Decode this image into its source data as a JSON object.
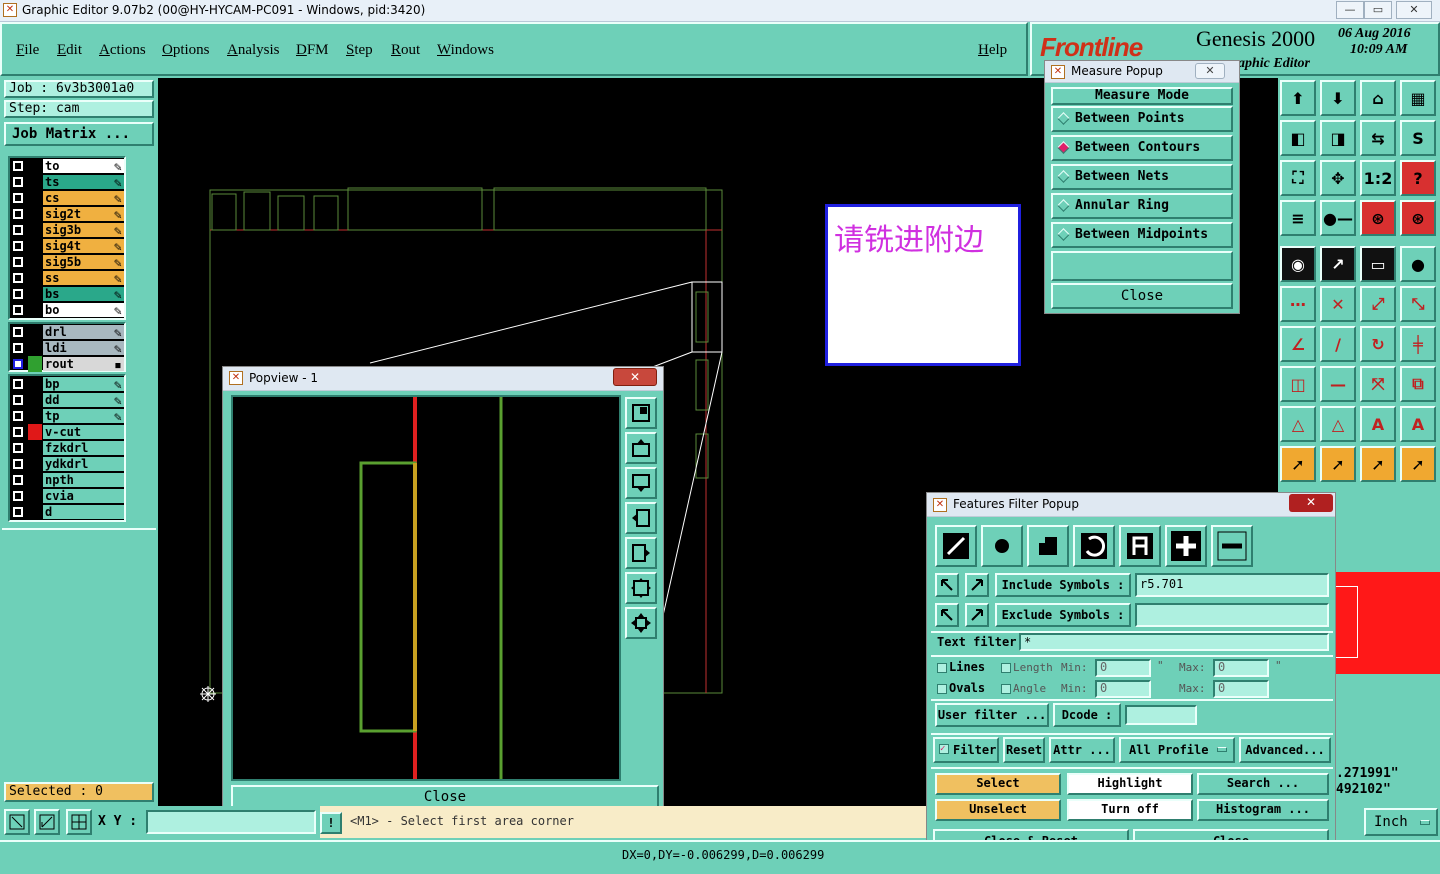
{
  "window": {
    "title": "Graphic Editor 9.07b2 (00@HY-HYCAM-PC091 - Windows, pid:3420)",
    "minimize": "—",
    "maximize": "▭",
    "close": "✕"
  },
  "menu": {
    "items": [
      "File",
      "Edit",
      "Actions",
      "Options",
      "Analysis",
      "DFM",
      "Step",
      "Rout",
      "Windows"
    ],
    "help": "Help"
  },
  "brand": {
    "logo": "Frontline",
    "product": "Genesis 2000",
    "date": "06 Aug 2016",
    "time": "10:09 AM",
    "subtitle": "aphic Editor"
  },
  "left": {
    "job": "Job : 6v3b3001a0",
    "step": "Step: cam",
    "job_matrix": "Job Matrix ...",
    "layers_group1": [
      {
        "name": "to",
        "color": "#ffffff"
      },
      {
        "name": "ts",
        "color": "#2aa88a"
      },
      {
        "name": "cs",
        "color": "#f0b040"
      },
      {
        "name": "sig2t",
        "color": "#f0b040"
      },
      {
        "name": "sig3b",
        "color": "#f0b040"
      },
      {
        "name": "sig4t",
        "color": "#f0b040"
      },
      {
        "name": "sig5b",
        "color": "#f0b040"
      },
      {
        "name": "ss",
        "color": "#f0b040"
      },
      {
        "name": "bs",
        "color": "#2aa88a"
      },
      {
        "name": "bo",
        "color": "#ffffff"
      }
    ],
    "layers_group2": [
      {
        "name": "drl",
        "color": "#a8b8c0"
      },
      {
        "name": "ldi",
        "color": "#a8b8c0"
      },
      {
        "name": "rout",
        "color": "#d8d8d8"
      }
    ],
    "layers_group3": [
      {
        "name": "bp",
        "color": "#6ed0b8"
      },
      {
        "name": "dd",
        "color": "#6ed0b8"
      },
      {
        "name": "tp",
        "color": "#6ed0b8"
      },
      {
        "name": "v-cut",
        "color": "#6ed0b8"
      },
      {
        "name": "fzkdrl",
        "color": "#6ed0b8"
      },
      {
        "name": "ydkdrl",
        "color": "#6ed0b8"
      },
      {
        "name": "npth",
        "color": "#6ed0b8"
      },
      {
        "name": "cvia",
        "color": "#6ed0b8"
      },
      {
        "name": "d",
        "color": "#6ed0b8"
      }
    ],
    "selected": "Selected : 0"
  },
  "note": {
    "text": "请铣进附边"
  },
  "popview": {
    "title": "Popview - 1",
    "close": "Close"
  },
  "measure": {
    "title": "Measure Popup",
    "mode_label": "Measure Mode",
    "items": [
      "Between Points",
      "Between Contours",
      "Between Nets",
      "Annular Ring",
      "Between Midpoints"
    ],
    "selected_index": 1,
    "close": "Close"
  },
  "ffp": {
    "title": "Features Filter Popup",
    "include_label": "Include Symbols :",
    "include_value": "r5.701",
    "exclude_label": "Exclude Symbols :",
    "exclude_value": "",
    "text_filter_label": "Text filter",
    "text_filter_value": "*",
    "lines": "Lines",
    "ovals": "Ovals",
    "length": "Length",
    "angle": "Angle",
    "min": "Min:",
    "max": "Max:",
    "min1": "0",
    "max1": "0",
    "min2": "0",
    "max2": "0",
    "deg": "\"",
    "user_filter": "User filter ...",
    "dcode": "Dcode :",
    "filter": "Filter",
    "reset": "Reset",
    "attr": "Attr ...",
    "all_profile": "All Profile",
    "advanced": "Advanced...",
    "select": "Select",
    "highlight": "Highlight",
    "search": "Search ...",
    "unselect": "Unselect",
    "turn_off": "Turn off",
    "histogram": "Histogram ...",
    "close_reset": "Close & Reset",
    "close": "Close"
  },
  "coords": {
    "x": ".271991\"",
    "y": "492102\""
  },
  "units": "Inch",
  "prompt": "<M1> - Select first area corner",
  "xy_label": "X Y :",
  "status": "DX=0,DY=-0.006299,D=0.006299"
}
